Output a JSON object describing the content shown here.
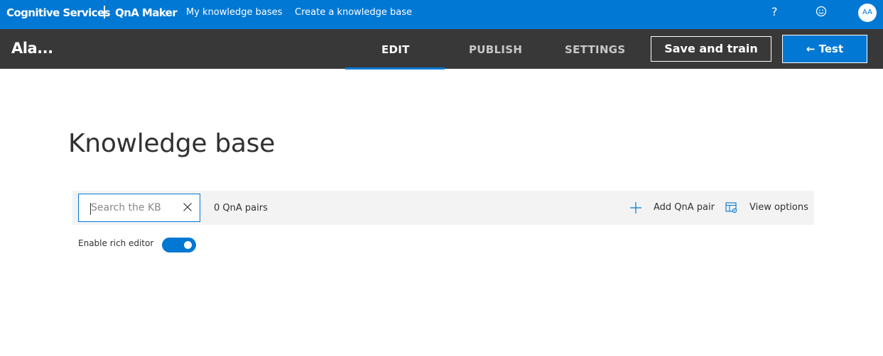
{
  "topbar": {
    "brand": "Cognitive Services",
    "product": "QnA Maker",
    "nav": [
      "My knowledge bases",
      "Create a knowledge base"
    ],
    "help": "?",
    "avatar_initials": "AA",
    "icons": [
      "help-icon",
      "smiley-feedback-icon"
    ]
  },
  "header": {
    "kb_name": "Ala...",
    "tabs": [
      {
        "label": "EDIT",
        "active": true
      },
      {
        "label": "PUBLISH",
        "active": false
      },
      {
        "label": "SETTINGS",
        "active": false
      }
    ],
    "save_label": "Save and train",
    "test_label": "← Test"
  },
  "main": {
    "title": "Knowledge base",
    "search": {
      "placeholder": "Search the KB",
      "value": ""
    },
    "qna_count": "0 QnA pairs",
    "add_label": "Add QnA pair",
    "view_label": "View options",
    "rich_editor_label": "Enable rich editor",
    "rich_editor_enabled": true
  },
  "colors": {
    "accent": "#0078d4",
    "header_bg": "#383838",
    "toolbar_bg": "#f3f3f3"
  }
}
